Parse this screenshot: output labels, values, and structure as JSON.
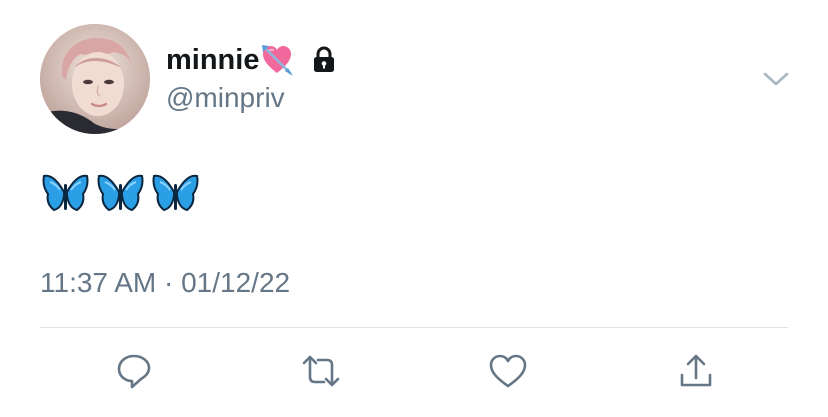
{
  "tweet": {
    "display_name": "minnie",
    "name_emoji": "heart-with-arrow",
    "protected_icon": "lock-icon",
    "handle": "@minpriv",
    "body_emojis": [
      "butterfly",
      "butterfly",
      "butterfly"
    ],
    "timestamp": "11:37 AM · 01/12/22"
  },
  "actions": [
    {
      "name": "reply",
      "icon": "reply-bubble-icon"
    },
    {
      "name": "retweet",
      "icon": "retweet-icon"
    },
    {
      "name": "like",
      "icon": "heart-outline-icon"
    },
    {
      "name": "share",
      "icon": "share-icon"
    }
  ],
  "colors": {
    "name_text": "#14171a",
    "secondary_text": "#657786",
    "icon_gray": "#657786",
    "divider": "#dfe3e6",
    "butterfly": "#2b9fe6",
    "heart_pink": "#f1699c"
  }
}
